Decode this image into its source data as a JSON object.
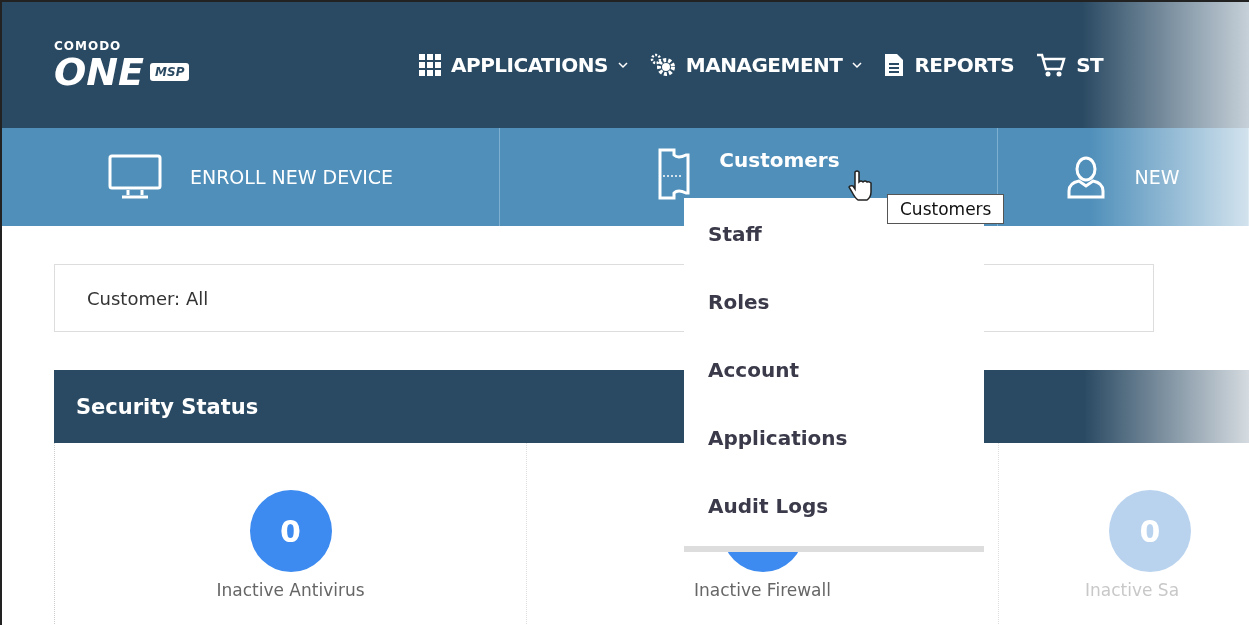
{
  "logo": {
    "brand": "COMODO",
    "product": "ONE",
    "edition": "MSP"
  },
  "nav": [
    {
      "label": "APPLICATIONS",
      "dropdown": true
    },
    {
      "label": "MANAGEMENT",
      "dropdown": true
    },
    {
      "label": "REPORTS",
      "dropdown": false
    },
    {
      "label": "ST",
      "dropdown": false
    }
  ],
  "actions": [
    {
      "label": "ENROLL NEW DEVICE",
      "selected": false
    },
    {
      "label": "Customers",
      "selected": true
    },
    {
      "label": "NEW",
      "selected": false
    }
  ],
  "menu": {
    "items": [
      "Staff",
      "Roles",
      "Account",
      "Applications",
      "Audit Logs"
    ]
  },
  "tooltip": "Customers",
  "filter": {
    "value": "Customer: All"
  },
  "security_status": {
    "title": "Security Status",
    "items": [
      {
        "value": "0",
        "label": "Inactive Antivirus"
      },
      {
        "label": "Inactive Firewall"
      },
      {
        "value": "0",
        "label": "Inactive Sa"
      }
    ]
  }
}
